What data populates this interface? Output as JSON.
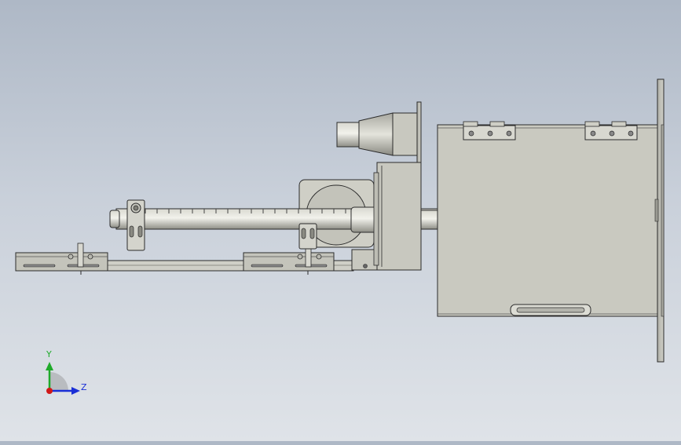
{
  "viewport": {
    "background_top": "#aeb8c6",
    "background_bottom": "#dfe3e8"
  },
  "model": {
    "body_color": "#c8c8bf",
    "edge_color": "#2b2b2b",
    "shadow_color": "#9a9a92",
    "highlight_color": "#e4e4dc"
  },
  "triad": {
    "y_label": "Y",
    "z_label": "Z",
    "y_color": "#1faa2a",
    "z_color": "#1a2fd6",
    "x_color": "#d01818"
  }
}
